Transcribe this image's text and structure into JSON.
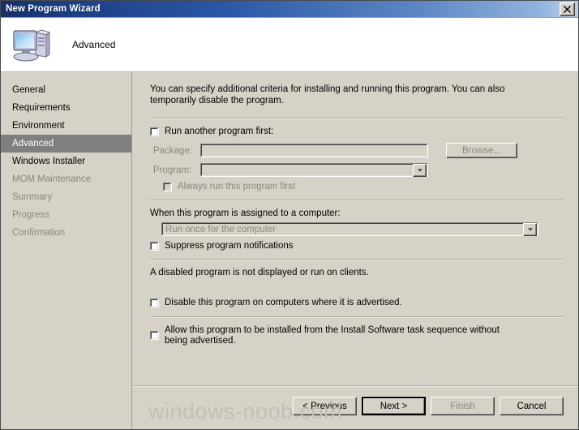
{
  "window": {
    "title": "New Program Wizard",
    "close_label": "✕",
    "header_title": "Advanced",
    "header_icon": "computer-icon"
  },
  "sidebar": {
    "items": [
      {
        "label": "General",
        "state": "normal"
      },
      {
        "label": "Requirements",
        "state": "normal"
      },
      {
        "label": "Environment",
        "state": "normal"
      },
      {
        "label": "Advanced",
        "state": "selected"
      },
      {
        "label": "Windows Installer",
        "state": "normal"
      },
      {
        "label": "MOM Maintenance",
        "state": "disabled"
      },
      {
        "label": "Summary",
        "state": "disabled"
      },
      {
        "label": "Progress",
        "state": "disabled"
      },
      {
        "label": "Confirmation",
        "state": "disabled"
      }
    ]
  },
  "main": {
    "intro": "You can specify additional criteria for installing and running this program. You can also temporarily disable the program.",
    "run_another_program_first": {
      "label": "Run another program first:",
      "checked": false
    },
    "package": {
      "label": "Package:",
      "value": "",
      "placeholder": ""
    },
    "program": {
      "label": "Program:",
      "value": "",
      "placeholder": ""
    },
    "browse_label": "Browse...",
    "always_run_first": {
      "label": "Always run this program first",
      "checked": false
    },
    "assigned_label": "When this program is assigned to a computer:",
    "assigned_value": "Run once for the computer",
    "suppress_notifications": {
      "label": "Suppress program notifications",
      "checked": false
    },
    "disabled_note": "A disabled program is not displayed or run on clients.",
    "disable_on_computers": {
      "label": "Disable this program on computers where it is advertised.",
      "checked": false
    },
    "allow_task_sequence": {
      "label": "Allow this program to be installed from the Install Software task sequence without being advertised.",
      "checked": false
    }
  },
  "buttons": {
    "previous": "< Previous",
    "next": "Next >",
    "finish": "Finish",
    "cancel": "Cancel"
  },
  "watermark": "windows-noob.com",
  "colors": {
    "title_start": "#14306b",
    "title_end": "#b9cfe8",
    "face": "#d6d2c8",
    "selected_nav": "#7f7f7f",
    "disabled_text": "#8a8780"
  }
}
